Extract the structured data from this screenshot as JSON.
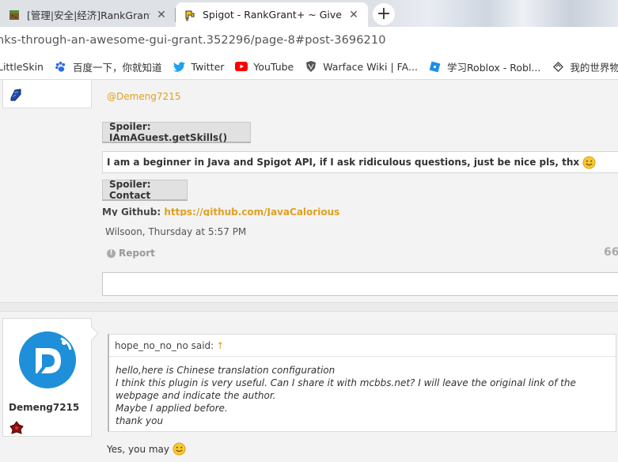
{
  "browser": {
    "tabs": [
      {
        "title": "[管理|安全|经济]RankGrant+—",
        "active": false
      },
      {
        "title": "Spigot - RankGrant+ ~ Give R",
        "active": true
      }
    ],
    "new_tab_label": "+",
    "url": "nks-through-an-awesome-gui-grant.352296/page-8#post-3696210",
    "bookmarks": [
      {
        "label": "LittleSkin",
        "icon": "littleskin-icon"
      },
      {
        "label": "百度一下，你就知道",
        "icon": "baidu-paw-icon"
      },
      {
        "label": "Twitter",
        "icon": "twitter-bird-icon"
      },
      {
        "label": "YouTube",
        "icon": "youtube-play-icon"
      },
      {
        "label": "Warface Wiki | FA...",
        "icon": "warface-icon"
      },
      {
        "label": "学习Roblox - Robl...",
        "icon": "roblox-icon"
      },
      {
        "label": "我的世界物品",
        "icon": "minecraft-icon"
      }
    ]
  },
  "post1": {
    "mention": "@Demeng7215",
    "spoiler_skills": "Spoiler: IAmAGuest.getSkills()",
    "signature_text": "I am a beginner in Java and Spigot API, if I ask ridiculous questions, just be nice pls, thx",
    "spoiler_contact": "Spoiler: Contact",
    "github_label": "My Github:",
    "github_link": "https://github.com/JavaCalorious",
    "meta": "Wilsoon, Thursday at 5:57 PM",
    "report_label": "Report",
    "quote_icon_label": "66"
  },
  "post2": {
    "username": "Demeng7215",
    "quote_author": "hope_no_no_no said:",
    "quote_arrow": "↑",
    "quote_lines": [
      "hello,here is Chinese translation configuration",
      "I think this plugin is very useful. Can I share it with mcbbs.net? I will leave the original link of the webpage and indicate the author.",
      "Maybe I applied before.",
      "thank you"
    ],
    "reply": "Yes, you may"
  },
  "colors": {
    "accent_link": "#e0a020",
    "avatar_blue": "#1e8fd8"
  }
}
